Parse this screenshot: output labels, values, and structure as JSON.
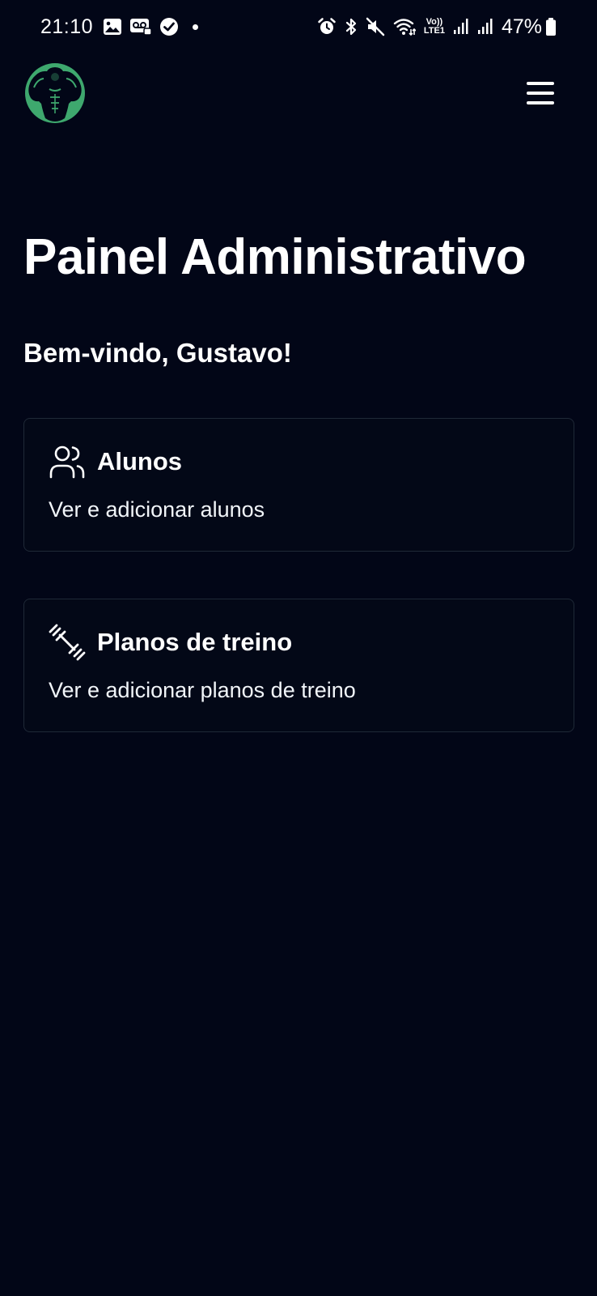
{
  "status_bar": {
    "time": "21:10",
    "battery": "47%",
    "network_label_top": "Vo))",
    "network_label_bottom": "LTE1",
    "icons_left": [
      "gallery-icon",
      "voicemail-icon",
      "check-circle-icon"
    ],
    "icons_right": [
      "alarm-icon",
      "bluetooth-icon",
      "mute-icon",
      "wifi-icon",
      "signal-icon",
      "signal-icon",
      "battery-icon"
    ]
  },
  "header": {
    "logo": "gym-bodybuilder-logo-icon",
    "menu": "hamburger-menu-icon"
  },
  "main": {
    "title": "Painel Administrativo",
    "welcome": "Bem-vindo, Gustavo!",
    "cards": [
      {
        "icon": "users-icon",
        "title": "Alunos",
        "description": "Ver e adicionar alunos"
      },
      {
        "icon": "dumbbell-icon",
        "title": "Planos de treino",
        "description": "Ver e adicionar planos de treino"
      }
    ]
  },
  "colors": {
    "background": "#020617",
    "card_border": "#1f2937",
    "text": "#ffffff",
    "logo_green": "#3ea86e"
  }
}
